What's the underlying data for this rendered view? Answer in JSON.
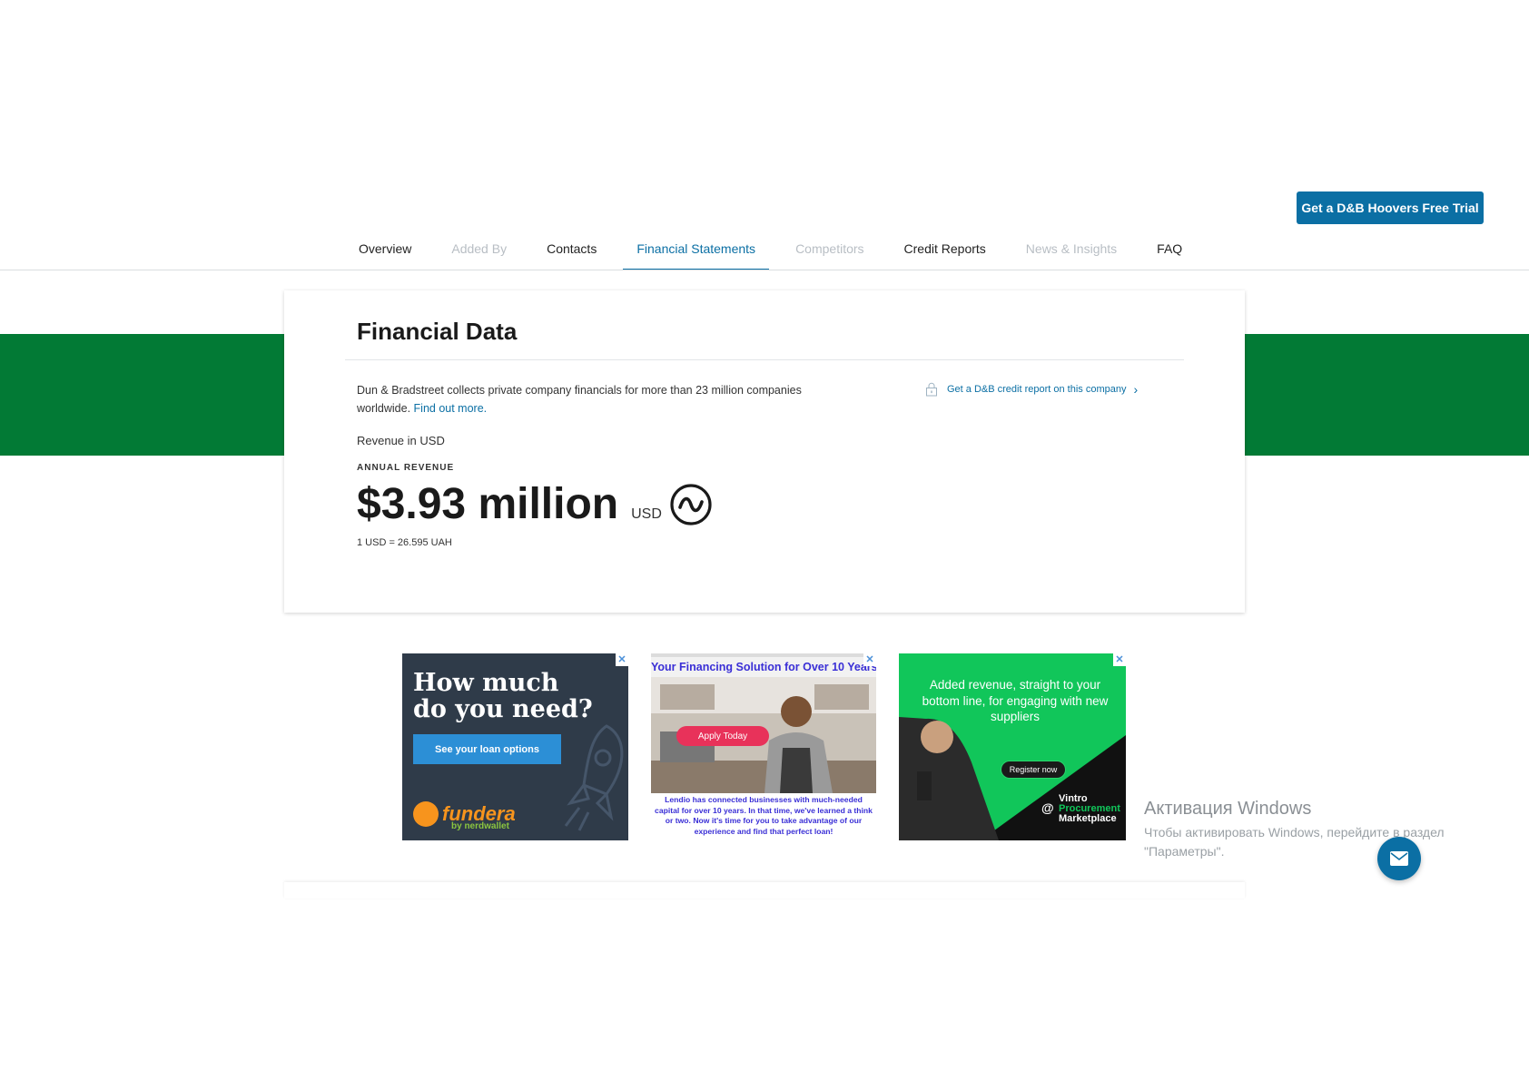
{
  "header": {
    "trial_button": "Get a D&B Hoovers Free Trial"
  },
  "tabs": [
    {
      "label": "Overview",
      "state": "normal"
    },
    {
      "label": "Added By",
      "state": "dim"
    },
    {
      "label": "Contacts",
      "state": "normal"
    },
    {
      "label": "Financial Statements",
      "state": "active"
    },
    {
      "label": "Competitors",
      "state": "dim"
    },
    {
      "label": "Credit Reports",
      "state": "normal"
    },
    {
      "label": "News & Insights",
      "state": "dim"
    },
    {
      "label": "FAQ",
      "state": "normal"
    }
  ],
  "financial": {
    "title": "Financial Data",
    "description": "Dun & Bradstreet collects private company financials for more than 23 million companies worldwide.",
    "find_out_more": "Find out more.",
    "credit_link": "Get a D&B credit report on this company",
    "revenue_label": "Revenue in USD",
    "annual_revenue_label": "ANNUAL REVENUE",
    "revenue_amount": "$3.93 million",
    "revenue_currency": "USD",
    "exchange_rate": "1 USD = 26.595 UAH"
  },
  "ads": {
    "fundera": {
      "headline": "How much do you need?",
      "button": "See your loan options",
      "brand": "fundera",
      "brand_sub": "by nerdwallet"
    },
    "lendio": {
      "headline": "Your Financing Solution for Over 10 Years",
      "button": "Apply Today",
      "body": "Lendio has connected businesses with much-needed capital for over 10 years. In that time, we've learned a think or two. Now it's time for you to take advantage of our experience and find that perfect loan!"
    },
    "vintro": {
      "headline": "Added revenue, straight to your bottom line, for engaging with new suppliers",
      "button": "Register now",
      "brand_line1": "Vintro",
      "brand_line2": "Procurement",
      "brand_line3": "Marketplace"
    }
  },
  "windows_watermark": {
    "title": "Активация Windows",
    "subtitle": "Чтобы активировать Windows, перейдите в раздел \"Параметры\"."
  },
  "colors": {
    "brand_blue": "#0b6fa4",
    "brand_green": "#027a35"
  },
  "icons": {
    "lock": "lock-icon",
    "chevron": "chevron-right-icon",
    "approx": "approximately-icon",
    "chat": "mail-icon"
  }
}
